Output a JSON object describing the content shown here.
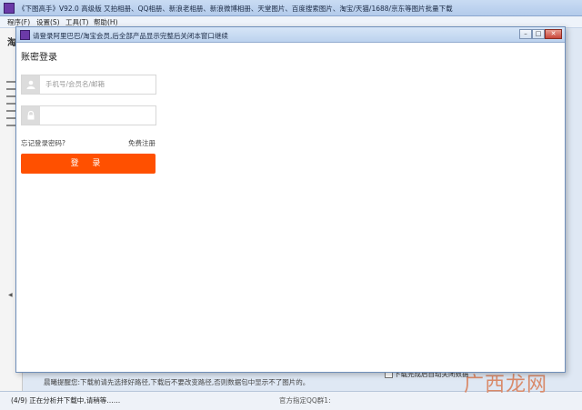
{
  "main_window": {
    "title": "《下图高手》V92.0  高级版  又拍相册、QQ相册、新浪老相册、新浪微博相册、天堂图片、百度搜索图片、淘宝/天猫/1688/京东等图片批量下载"
  },
  "menu": [
    {
      "label": "程序(F)"
    },
    {
      "label": "设置(S)"
    },
    {
      "label": "工具(T)"
    },
    {
      "label": "帮助(H)"
    }
  ],
  "left_panel": {
    "heading_glyph": "淘"
  },
  "dialog": {
    "title": "请登录阿里巴巴/淘宝会员,后全部产品显示完整后关闭本窗口继续",
    "login_title": "账密登录",
    "username_placeholder": "手机号/会员名/邮箱",
    "password_value": "",
    "forgot_password": "忘记登录密码?",
    "register": "免费注册",
    "login_button": "登 录"
  },
  "bottom": {
    "hint": "晨曦提醒您:下载前请先选择好路径,下载后不要改变路径,否则数据包中显示不了图片的。",
    "checkbox_label": "下载完成后自动关闭数据"
  },
  "status": {
    "progress": "(4/9) 正在分析并下载中,请稍等……",
    "official_group": "官方指定QQ群1:"
  },
  "watermark": {
    "text": "广西龙网"
  },
  "colors": {
    "accent": "#ff5000",
    "titlebar": "#bcd2ee"
  }
}
